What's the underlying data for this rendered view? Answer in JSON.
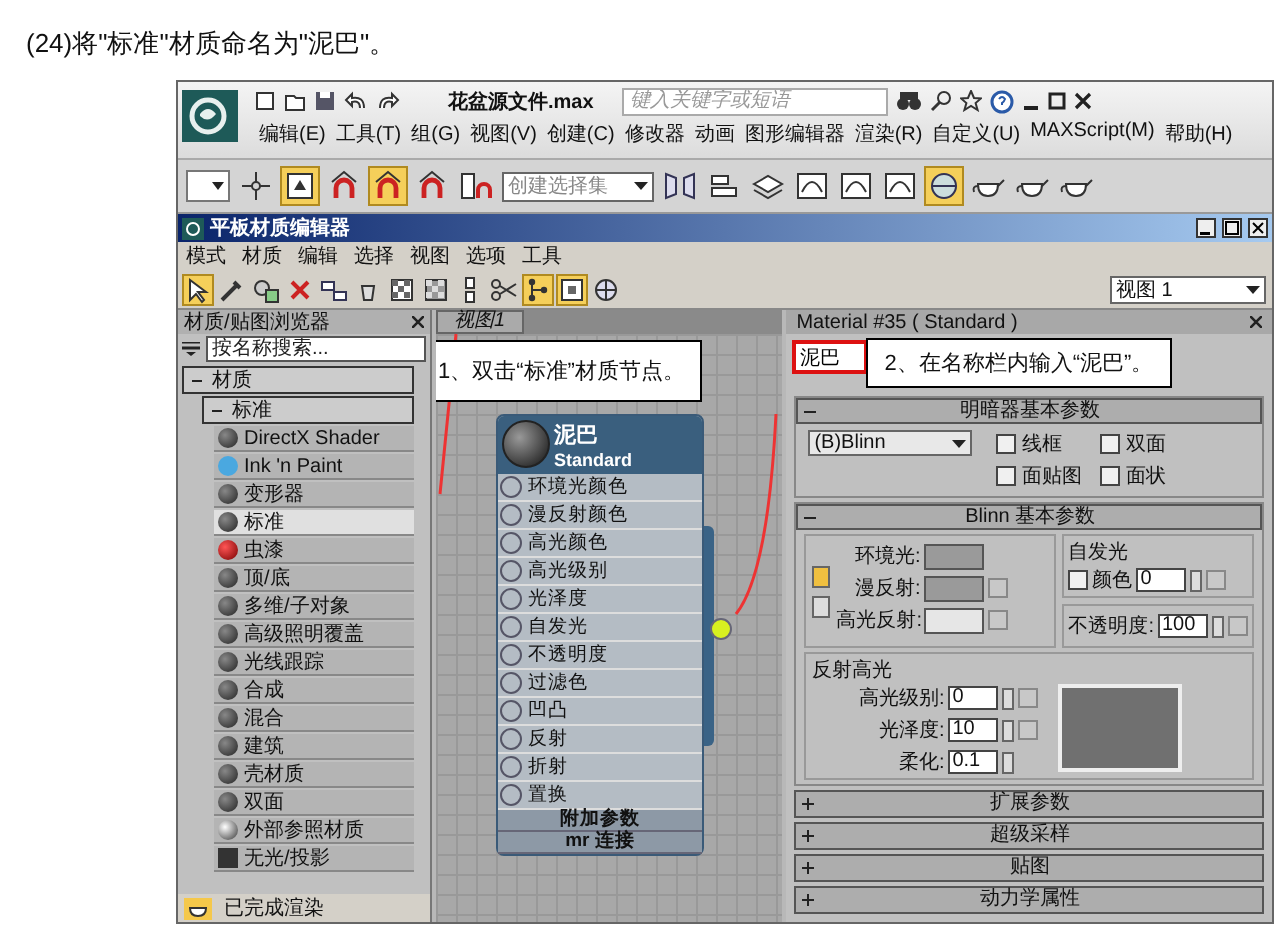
{
  "caption": "(24)将\"标准\"材质命名为\"泥巴\"。",
  "app": {
    "title": "花盆源文件.max",
    "search_placeholder": "键入关键字或短语",
    "menu": [
      "编辑(E)",
      "工具(T)",
      "组(G)",
      "视图(V)",
      "创建(C)",
      "修改器",
      "动画",
      "图形编辑器",
      "渲染(R)",
      "自定义(U)",
      "MAXScript(M)",
      "帮助(H)"
    ],
    "selection_set_placeholder": "创建选择集"
  },
  "editor": {
    "title": "平板材质编辑器",
    "menu": [
      "模式",
      "材质",
      "编辑",
      "选择",
      "视图",
      "选项",
      "工具"
    ],
    "view_select": "视图 1"
  },
  "browser": {
    "title": "材质/贴图浏览器",
    "search_placeholder": "按名称搜索...",
    "category": {
      "label": "材质",
      "expanded": true
    },
    "subcategory": {
      "label": "标准",
      "expanded": true
    },
    "items": [
      {
        "label": "DirectX Shader",
        "kind": "sphere",
        "selected": false
      },
      {
        "label": "Ink 'n Paint",
        "kind": "flat",
        "selected": false
      },
      {
        "label": "变形器",
        "kind": "sphere",
        "selected": false
      },
      {
        "label": "标准",
        "kind": "sphere",
        "selected": true
      },
      {
        "label": "虫漆",
        "kind": "lacquer",
        "selected": false
      },
      {
        "label": "顶/底",
        "kind": "sphere",
        "selected": false
      },
      {
        "label": "多维/子对象",
        "kind": "sphere",
        "selected": false
      },
      {
        "label": "高级照明覆盖",
        "kind": "sphere",
        "selected": false
      },
      {
        "label": "光线跟踪",
        "kind": "sphere",
        "selected": false
      },
      {
        "label": "合成",
        "kind": "sphere",
        "selected": false
      },
      {
        "label": "混合",
        "kind": "sphere",
        "selected": false
      },
      {
        "label": "建筑",
        "kind": "sphere",
        "selected": false
      },
      {
        "label": "壳材质",
        "kind": "sphere",
        "selected": false
      },
      {
        "label": "双面",
        "kind": "sphere",
        "selected": false
      },
      {
        "label": "外部参照材质",
        "kind": "xref",
        "selected": false
      },
      {
        "label": "无光/投影",
        "kind": "matte",
        "selected": false
      }
    ],
    "status": "已完成渲染"
  },
  "view": {
    "tab": "视图1",
    "callout": "1、双击“标准”材质节点。",
    "node": {
      "name": "泥巴",
      "type": "Standard",
      "slots": [
        "环境光颜色",
        "漫反射颜色",
        "高光颜色",
        "高光级别",
        "光泽度",
        "自发光",
        "不透明度",
        "过滤色",
        "凹凸",
        "反射",
        "折射",
        "置换"
      ],
      "rollouts": [
        "附加参数",
        "mr 连接"
      ]
    }
  },
  "inspector": {
    "title": "Material #35 ( Standard )",
    "name_value": "泥巴",
    "callout": "2、在名称栏内输入“泥巴”。",
    "shader_rollout": {
      "title": "明暗器基本参数",
      "expanded": true,
      "shader": "(B)Blinn",
      "options": [
        {
          "label": "线框",
          "checked": false
        },
        {
          "label": "双面",
          "checked": false
        },
        {
          "label": "面贴图",
          "checked": false
        },
        {
          "label": "面状",
          "checked": false
        }
      ]
    },
    "blinn_rollout": {
      "title": "Blinn 基本参数",
      "expanded": true,
      "colors": [
        {
          "label": "环境光:",
          "color": "#9a9a9a"
        },
        {
          "label": "漫反射:",
          "color": "#9a9a9a"
        },
        {
          "label": "高光反射:",
          "color": "#e6e6e6"
        }
      ],
      "self_illum": {
        "title": "自发光",
        "label": "颜色",
        "checked": false,
        "value": "0"
      },
      "opacity": {
        "label": "不透明度:",
        "value": "100"
      },
      "highlights": {
        "title": "反射高光",
        "fields": [
          {
            "label": "高光级别:",
            "value": "0"
          },
          {
            "label": "光泽度:",
            "value": "10"
          },
          {
            "label": "柔化:",
            "value": "0.1"
          }
        ]
      }
    },
    "rollouts": [
      {
        "title": "扩展参数",
        "expanded": false
      },
      {
        "title": "超级采样",
        "expanded": false
      },
      {
        "title": "贴图",
        "expanded": false
      },
      {
        "title": "动力学属性",
        "expanded": false
      }
    ]
  }
}
